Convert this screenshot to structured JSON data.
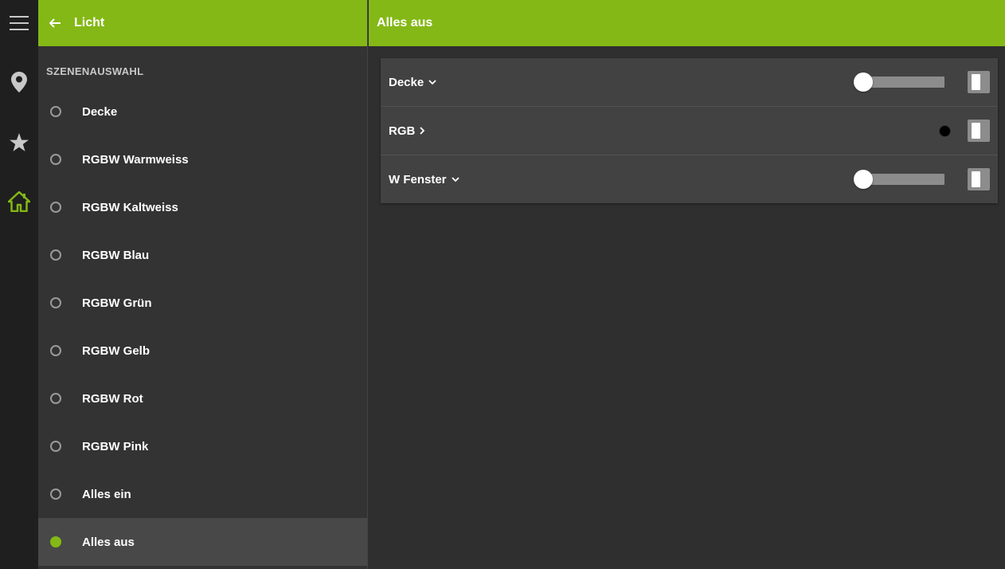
{
  "rail": {
    "items": [
      {
        "icon": "menu-icon"
      },
      {
        "icon": "location-pin-icon"
      },
      {
        "icon": "star-icon"
      },
      {
        "icon": "home-icon"
      }
    ],
    "active_color": "#84b816",
    "icon_color": "#c8c8c8"
  },
  "left": {
    "title": "Licht",
    "section_label": "SZENENAUSWAHL",
    "scenes": [
      {
        "label": "Decke",
        "selected": false
      },
      {
        "label": "RGBW Warmweiss",
        "selected": false
      },
      {
        "label": "RGBW Kaltweiss",
        "selected": false
      },
      {
        "label": "RGBW Blau",
        "selected": false
      },
      {
        "label": "RGBW Grün",
        "selected": false
      },
      {
        "label": "RGBW Gelb",
        "selected": false
      },
      {
        "label": "RGBW Rot",
        "selected": false
      },
      {
        "label": "RGBW Pink",
        "selected": false
      },
      {
        "label": "Alles ein",
        "selected": false
      },
      {
        "label": "Alles aus",
        "selected": true
      }
    ]
  },
  "right": {
    "title": "Alles aus",
    "rows": [
      {
        "label": "Decke",
        "chevron": "down",
        "control": "slider",
        "dim_level": 0,
        "switch_on": false
      },
      {
        "label": "RGB",
        "chevron": "right",
        "control": "color",
        "color": "#000000",
        "switch_on": false
      },
      {
        "label": "W Fenster",
        "chevron": "down",
        "control": "slider",
        "dim_level": 0,
        "switch_on": false
      }
    ]
  },
  "colors": {
    "accent": "#84b816",
    "panel": "#333333",
    "card": "#424242",
    "background": "#2f2f2f"
  }
}
